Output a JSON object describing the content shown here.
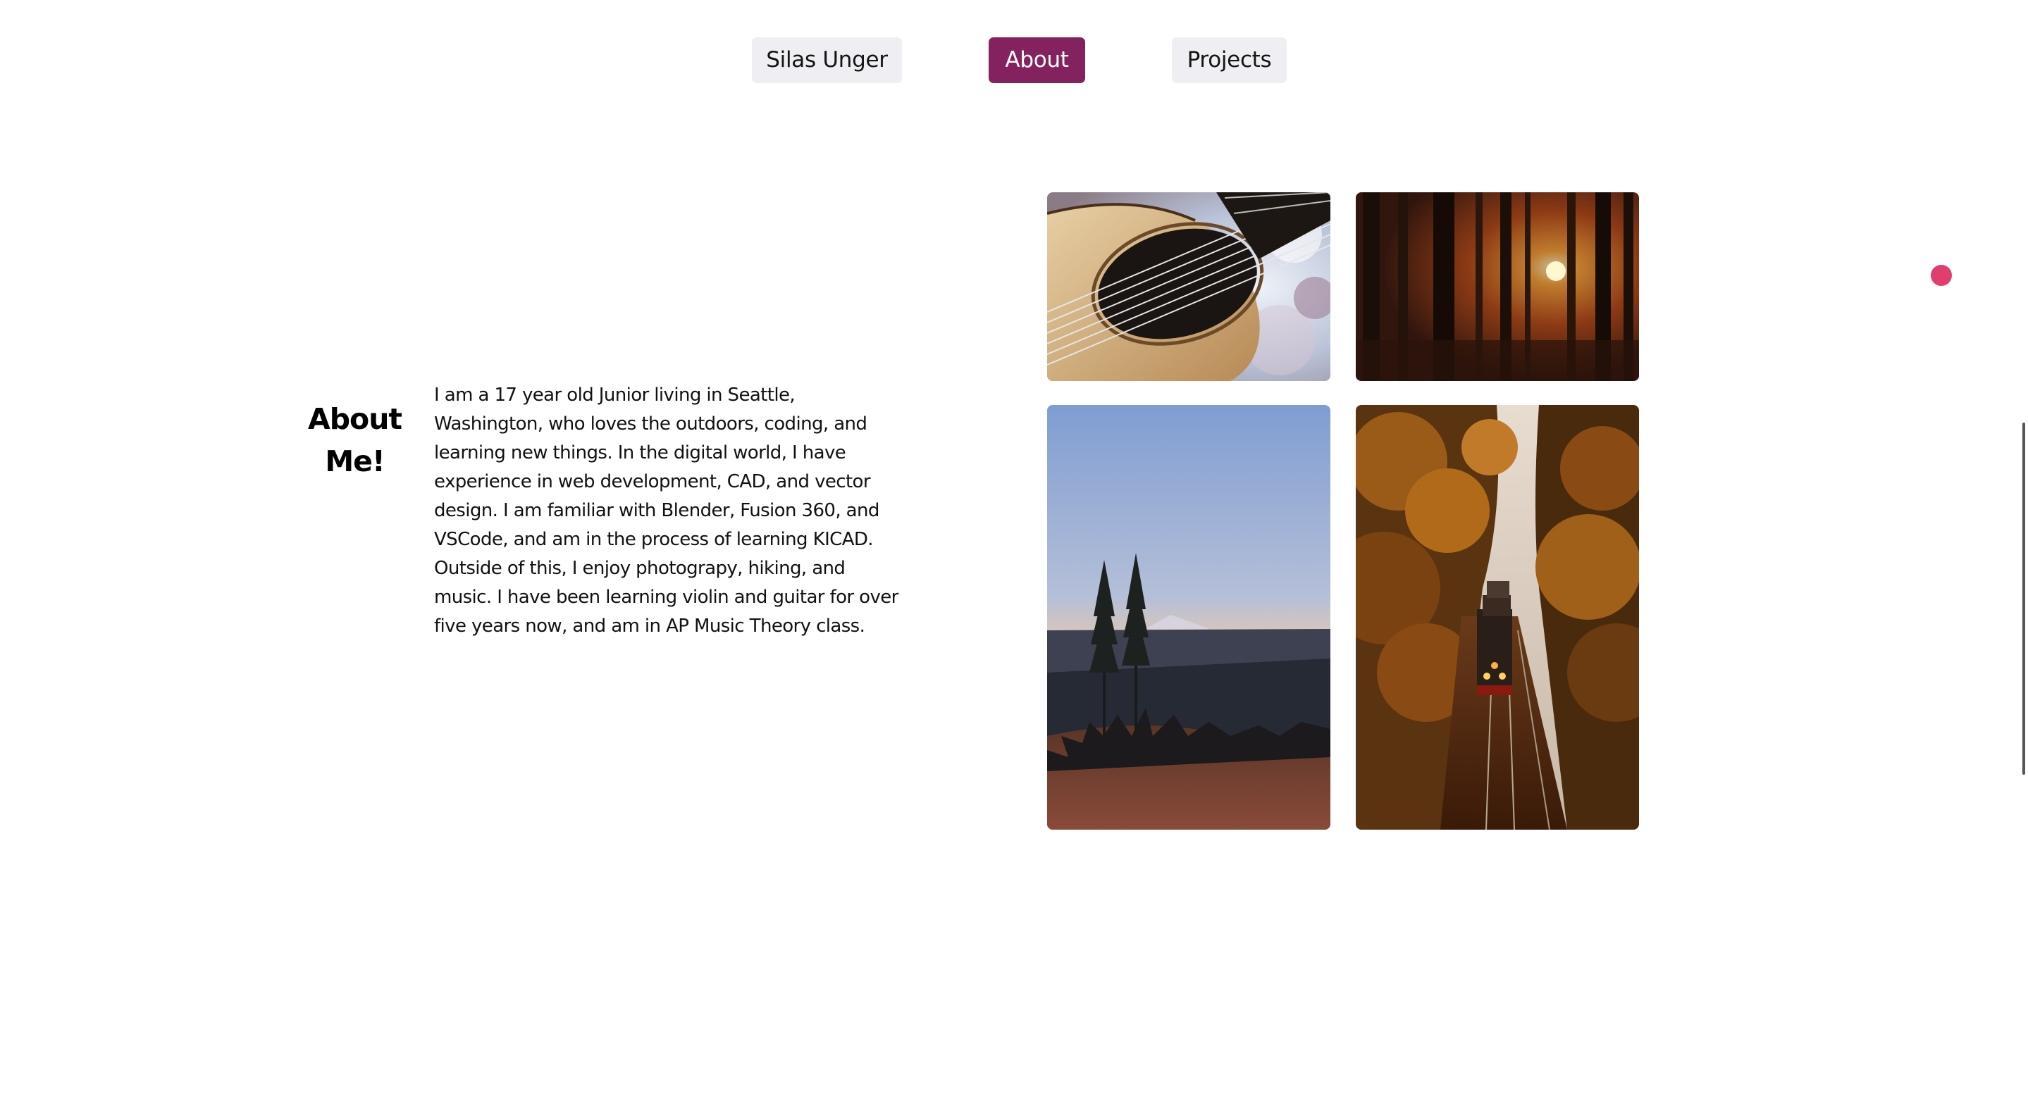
{
  "nav": {
    "items": [
      {
        "label": "Silas Unger",
        "active": false
      },
      {
        "label": "About",
        "active": true
      },
      {
        "label": "Projects",
        "active": false
      }
    ],
    "active_color": "#84225f",
    "inactive_color": "#efeff3"
  },
  "about": {
    "title_line1": "About",
    "title_line2": "Me!",
    "paragraph_lines": [
      "I am a 17 year old Junior living in Seattle,",
      "Washington, who loves the outdoors, coding, and",
      "learning new things. In the digital world, I have",
      "experience in web development, CAD, and vector",
      "design. I am familiar with Blender, Fusion 360, and",
      "VSCode, and am in the process of learning KICAD.",
      "Outside of this, I enjoy photograpy, hiking, and",
      "music. I have been learning violin and guitar for over",
      "five years now, and am in AP Music Theory class."
    ]
  },
  "gallery": {
    "photos": [
      {
        "name": "guitar-photo"
      },
      {
        "name": "forest-sunset-photo"
      },
      {
        "name": "mountain-dusk-photo"
      },
      {
        "name": "autumn-train-photo"
      }
    ]
  },
  "accent_dot_color": "#e03e6c"
}
